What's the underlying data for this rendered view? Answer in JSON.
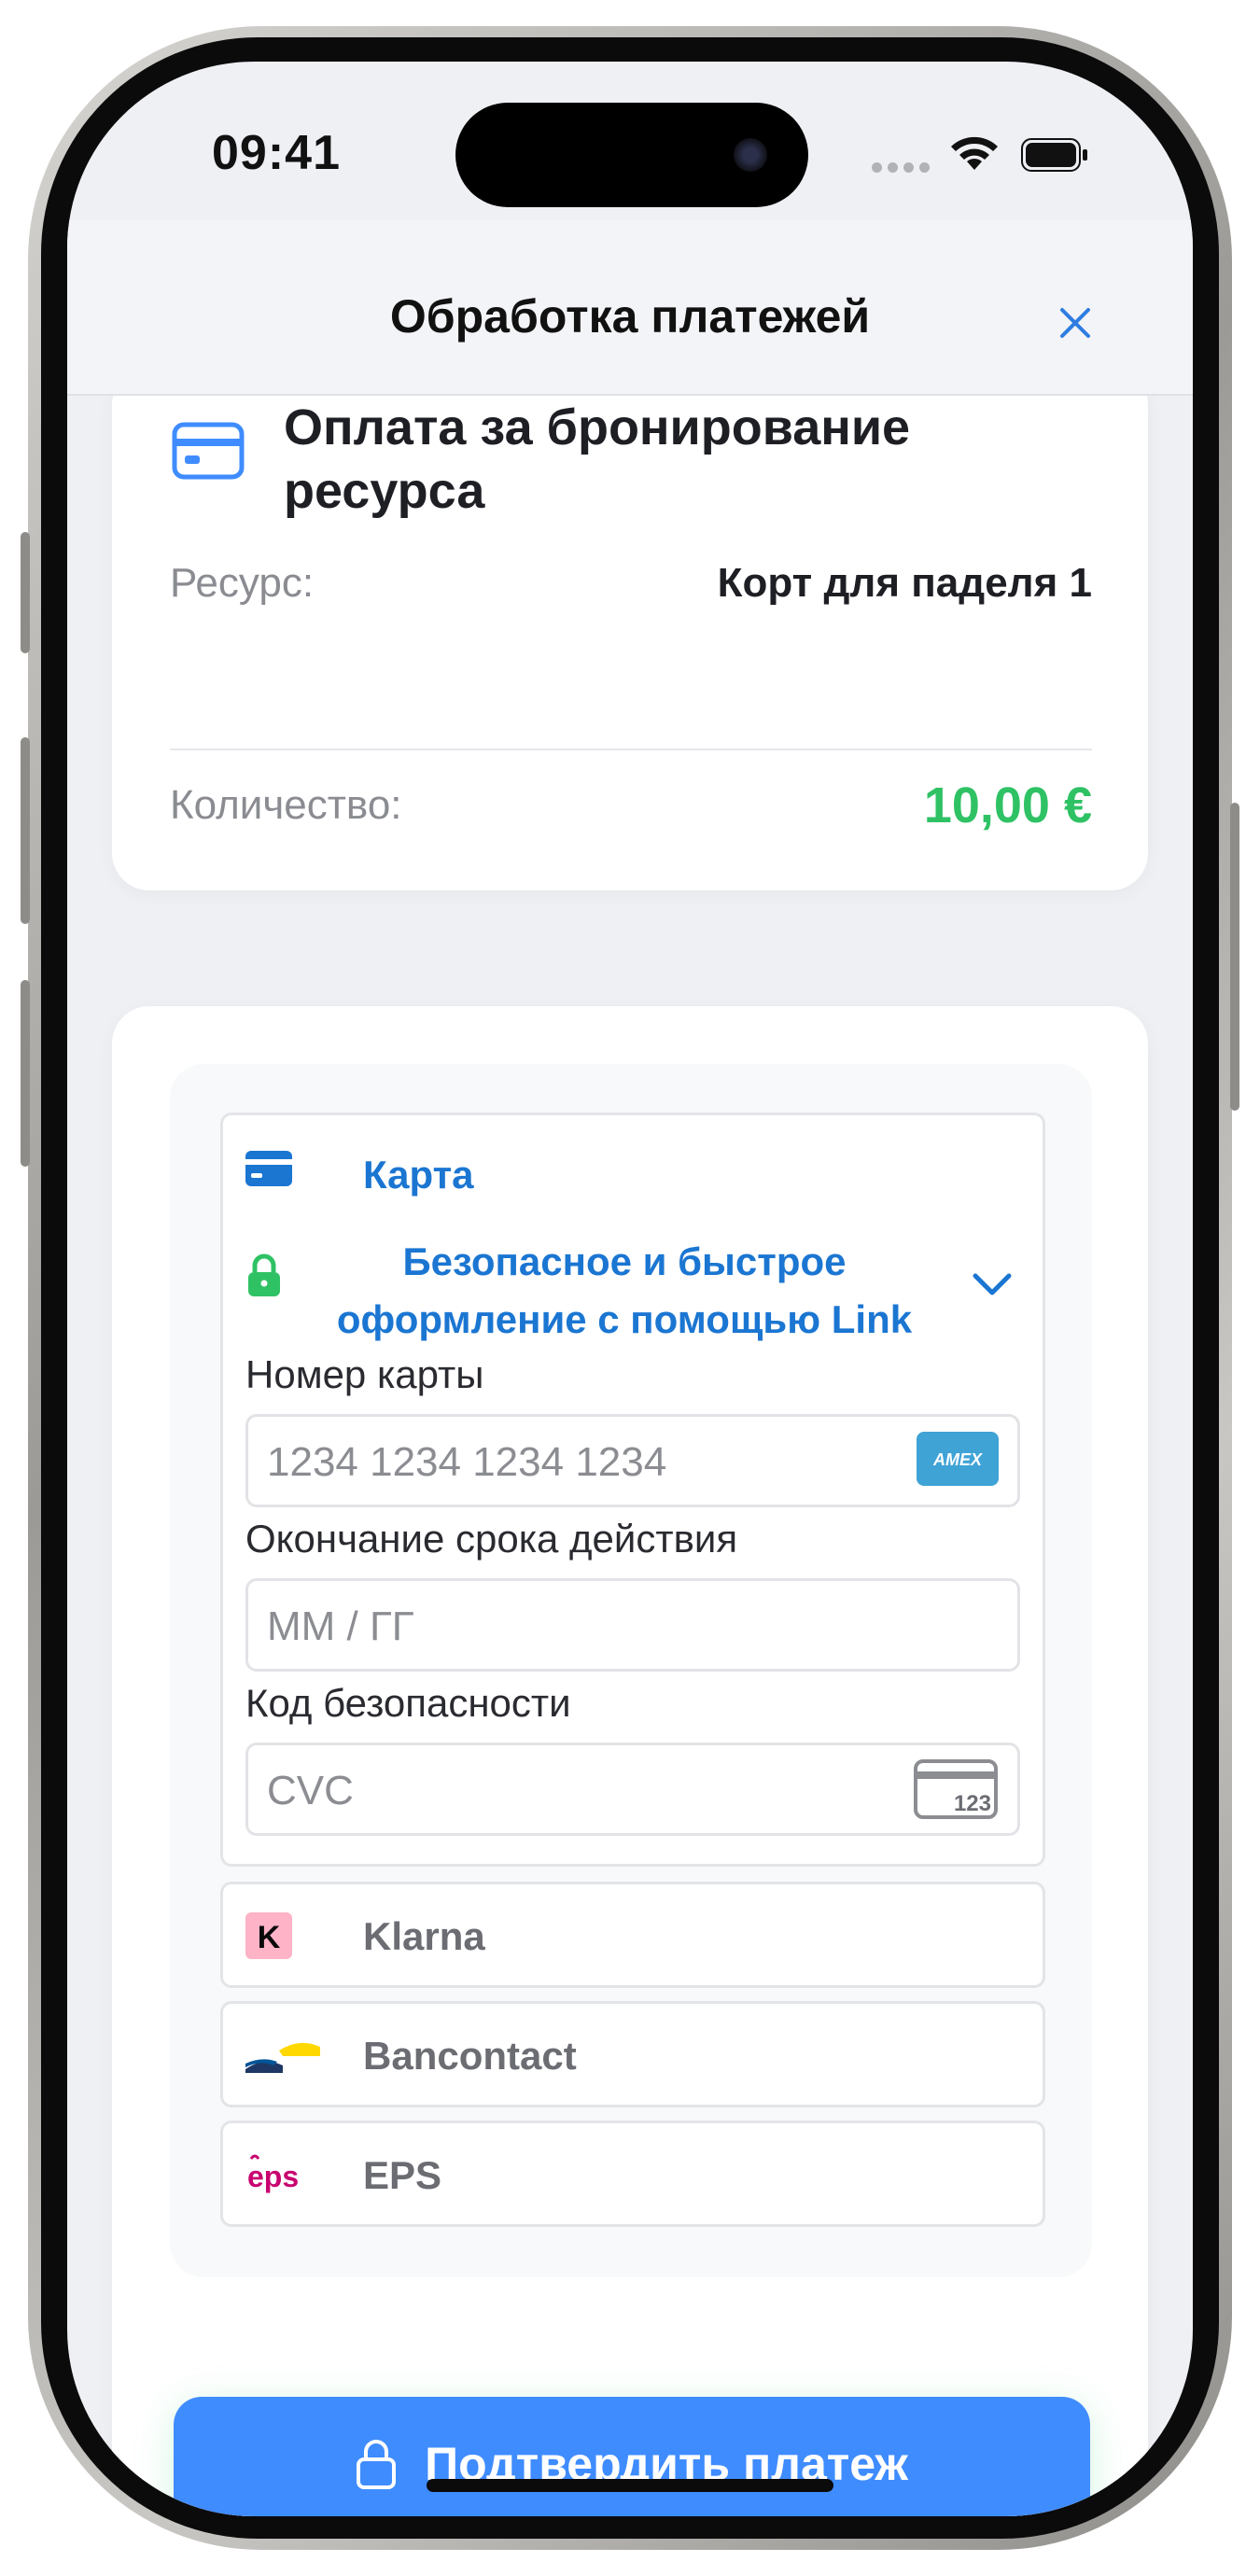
{
  "status_bar": {
    "time": "09:41"
  },
  "header": {
    "title": "Обработка платежей",
    "close_icon": "close-icon"
  },
  "summary": {
    "icon": "credit-card-icon",
    "title": "Оплата за бронирование ресурса",
    "resource_label": "Ресурс:",
    "resource_value": "Корт для паделя 1",
    "quantity_label": "Количество:",
    "amount": "10,00 €",
    "amount_color": "#2fc265"
  },
  "payment": {
    "card": {
      "label": "Карта",
      "link_text": "Безопасное и быстрое оформление с помощью Link",
      "card_number_label": "Номер карты",
      "card_number_placeholder": "1234 1234 1234 1234",
      "card_brand": "AMEX",
      "expiry_label": "Окончание срока действия",
      "expiry_placeholder": "ММ / ГГ",
      "cvc_label": "Код безопасности",
      "cvc_placeholder": "CVC",
      "cvc_icon_text": "123"
    },
    "methods": [
      {
        "label": "Klarna",
        "icon": "klarna-icon",
        "badge": "K"
      },
      {
        "label": "Bancontact",
        "icon": "bancontact-icon"
      },
      {
        "label": "EPS",
        "icon": "eps-icon",
        "badge": "eps"
      }
    ]
  },
  "confirm_button": {
    "label": "Подтвердить платеж",
    "icon": "lock-icon"
  },
  "colors": {
    "accent": "#3f8cff",
    "link_blue": "#1b76d2",
    "success": "#2fc265"
  }
}
